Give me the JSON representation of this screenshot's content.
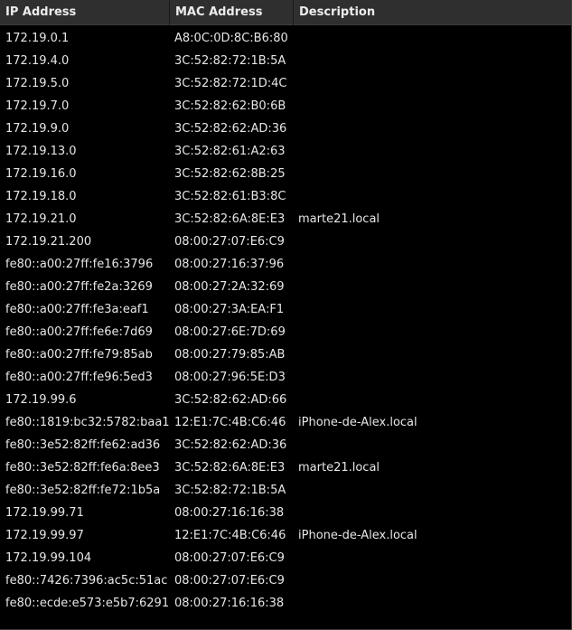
{
  "table": {
    "columns": [
      "IP Address",
      "MAC Address",
      "Description"
    ],
    "rows": [
      {
        "ip": "172.19.0.1",
        "mac": "A8:0C:0D:8C:B6:80",
        "desc": ""
      },
      {
        "ip": "172.19.4.0",
        "mac": "3C:52:82:72:1B:5A",
        "desc": ""
      },
      {
        "ip": "172.19.5.0",
        "mac": "3C:52:82:72:1D:4C",
        "desc": ""
      },
      {
        "ip": "172.19.7.0",
        "mac": "3C:52:82:62:B0:6B",
        "desc": ""
      },
      {
        "ip": "172.19.9.0",
        "mac": "3C:52:82:62:AD:36",
        "desc": ""
      },
      {
        "ip": "172.19.13.0",
        "mac": "3C:52:82:61:A2:63",
        "desc": ""
      },
      {
        "ip": "172.19.16.0",
        "mac": "3C:52:82:62:8B:25",
        "desc": ""
      },
      {
        "ip": "172.19.18.0",
        "mac": "3C:52:82:61:B3:8C",
        "desc": ""
      },
      {
        "ip": "172.19.21.0",
        "mac": "3C:52:82:6A:8E:E3",
        "desc": "marte21.local"
      },
      {
        "ip": "172.19.21.200",
        "mac": "08:00:27:07:E6:C9",
        "desc": ""
      },
      {
        "ip": "fe80::a00:27ff:fe16:3796",
        "mac": "08:00:27:16:37:96",
        "desc": ""
      },
      {
        "ip": "fe80::a00:27ff:fe2a:3269",
        "mac": "08:00:27:2A:32:69",
        "desc": ""
      },
      {
        "ip": "fe80::a00:27ff:fe3a:eaf1",
        "mac": "08:00:27:3A:EA:F1",
        "desc": ""
      },
      {
        "ip": "fe80::a00:27ff:fe6e:7d69",
        "mac": "08:00:27:6E:7D:69",
        "desc": ""
      },
      {
        "ip": "fe80::a00:27ff:fe79:85ab",
        "mac": "08:00:27:79:85:AB",
        "desc": ""
      },
      {
        "ip": "fe80::a00:27ff:fe96:5ed3",
        "mac": "08:00:27:96:5E:D3",
        "desc": ""
      },
      {
        "ip": "172.19.99.6",
        "mac": "3C:52:82:62:AD:66",
        "desc": ""
      },
      {
        "ip": "fe80::1819:bc32:5782:baa1",
        "mac": "12:E1:7C:4B:C6:46",
        "desc": "iPhone-de-Alex.local"
      },
      {
        "ip": "fe80::3e52:82ff:fe62:ad36",
        "mac": "3C:52:82:62:AD:36",
        "desc": ""
      },
      {
        "ip": "fe80::3e52:82ff:fe6a:8ee3",
        "mac": "3C:52:82:6A:8E:E3",
        "desc": "marte21.local"
      },
      {
        "ip": "fe80::3e52:82ff:fe72:1b5a",
        "mac": "3C:52:82:72:1B:5A",
        "desc": ""
      },
      {
        "ip": "172.19.99.71",
        "mac": "08:00:27:16:16:38",
        "desc": ""
      },
      {
        "ip": "172.19.99.97",
        "mac": "12:E1:7C:4B:C6:46",
        "desc": "iPhone-de-Alex.local"
      },
      {
        "ip": "172.19.99.104",
        "mac": "08:00:27:07:E6:C9",
        "desc": ""
      },
      {
        "ip": "fe80::7426:7396:ac5c:51ac",
        "mac": "08:00:27:07:E6:C9",
        "desc": ""
      },
      {
        "ip": "fe80::ecde:e573:e5b7:6291",
        "mac": "08:00:27:16:16:38",
        "desc": ""
      }
    ]
  }
}
